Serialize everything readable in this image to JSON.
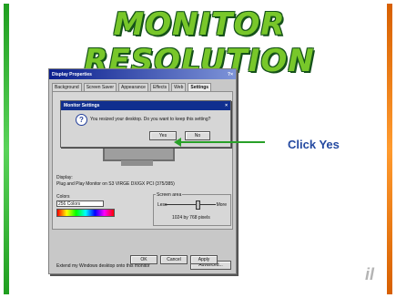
{
  "slide": {
    "title": "MONITOR RESOLUTION",
    "annotation": "Click Yes",
    "logo_text": "il"
  },
  "display_properties": {
    "title": "Display Properties",
    "title_controls": "?×",
    "tabs": [
      "Background",
      "Screen Saver",
      "Appearance",
      "Effects",
      "Web",
      "Settings"
    ],
    "display_label": "Display:",
    "display_value": "Plug and Play Monitor on S3 VIRGE DX/GX PCI (375/385)",
    "colors_label": "Colors",
    "colors_value": "256 Colors",
    "screen_area_label": "Screen area",
    "less_label": "Less",
    "more_label": "More",
    "resolution_value": "1024 by 768 pixels",
    "extra_option": "Extend my Windows desktop onto this monitor",
    "advanced_label": "Advanced...",
    "ok_label": "OK",
    "cancel_label": "Cancel",
    "apply_label": "Apply"
  },
  "monitor_settings": {
    "title": "Monitor Settings",
    "close_symbol": "×",
    "question_symbol": "?",
    "message": "You resized your desktop. Do you want to keep this setting?",
    "yes_label": "Yes",
    "no_label": "No"
  },
  "icons": {
    "question": "question-icon",
    "arrow": "left-arrow-icon"
  },
  "colors": {
    "green": "#78c72a",
    "blue": "#2449a0"
  }
}
